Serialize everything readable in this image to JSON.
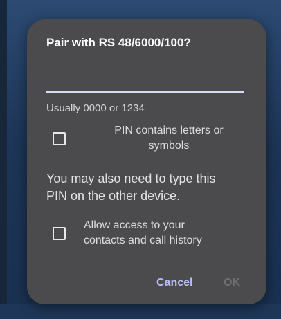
{
  "dialog": {
    "title": "Pair with RS 48/6000/100?",
    "pin_input": {
      "value": "",
      "placeholder": ""
    },
    "hint": "Usually 0000 or 1234",
    "pin_letters_checkbox": {
      "label_line1": "PIN contains letters or",
      "label_line2": "symbols",
      "checked": false
    },
    "info_line1": "You may also need to type this",
    "info_line2": "PIN on the other device.",
    "contacts_checkbox": {
      "label_line1": "Allow access to your",
      "label_line2": "contacts and call history",
      "checked": false
    },
    "cancel_label": "Cancel",
    "ok_label": "OK"
  },
  "colors": {
    "dialog_background": "#4b4b4d",
    "accent": "#b8bef8",
    "disabled_text": "#6f6f72",
    "underline": "#d9dcf7"
  }
}
